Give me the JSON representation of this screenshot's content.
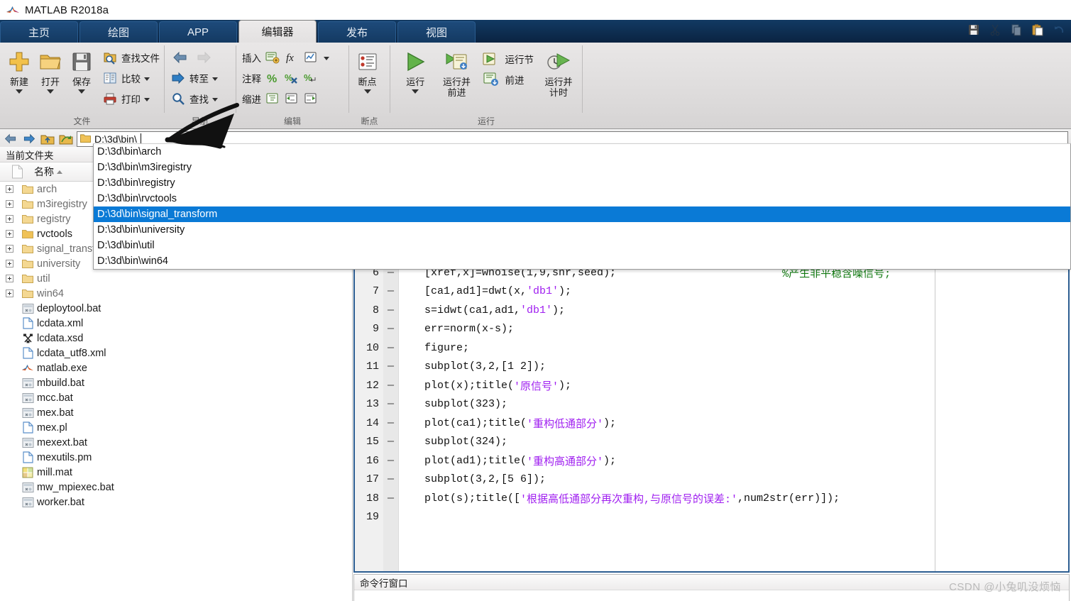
{
  "window": {
    "title": "MATLAB R2018a",
    "logo_icon": "matlab-logo-icon"
  },
  "quick_access": [
    {
      "name": "save-icon",
      "label": "保存",
      "enabled": true
    },
    {
      "name": "cut-icon",
      "label": "剪切",
      "enabled": false
    },
    {
      "name": "copy-icon",
      "label": "复制",
      "enabled": false
    },
    {
      "name": "paste-icon",
      "label": "粘贴",
      "enabled": true
    },
    {
      "name": "undo-icon",
      "label": "撤消",
      "enabled": false
    }
  ],
  "ribbon": {
    "tabs": [
      {
        "label": "主页",
        "active": false
      },
      {
        "label": "绘图",
        "active": false
      },
      {
        "label": "APP",
        "active": false
      },
      {
        "label": "编辑器",
        "active": true
      },
      {
        "label": "发布",
        "active": false
      },
      {
        "label": "视图",
        "active": false
      }
    ],
    "groups": [
      {
        "label": "文件",
        "big_buttons": [
          {
            "label": "新建",
            "icon": "new-file-icon",
            "has_menu": true
          },
          {
            "label": "打开",
            "icon": "open-folder-icon",
            "has_menu": true
          },
          {
            "label": "保存",
            "icon": "save-disk-icon",
            "has_menu": true
          }
        ],
        "small_buttons": [
          {
            "label": "查找文件",
            "icon": "find-files-icon",
            "has_menu": false
          },
          {
            "label": "比较",
            "icon": "compare-icon",
            "has_menu": true
          },
          {
            "label": "打印",
            "icon": "print-icon",
            "has_menu": true
          }
        ]
      },
      {
        "label": "导航",
        "small_buttons": [
          {
            "label": "",
            "icon": "back-arrow-icon",
            "has_menu": false
          },
          {
            "label": "",
            "icon": "forward-arrow-icon",
            "has_menu": false
          },
          {
            "label": "转至",
            "icon": "goto-icon",
            "has_menu": true
          },
          {
            "label": "查找",
            "icon": "search-icon",
            "has_menu": true
          }
        ]
      },
      {
        "label": "编辑",
        "rows": [
          {
            "label": "插入",
            "icons": [
              "insert-block-icon",
              "insert-function-icon",
              "insert-section-icon"
            ],
            "has_menu": true
          },
          {
            "label": "注释",
            "icons": [
              "comment-icon",
              "uncomment-icon",
              "wrap-comment-icon"
            ],
            "has_menu": false
          },
          {
            "label": "缩进",
            "icons": [
              "smart-indent-icon",
              "indent-right-icon",
              "indent-left-icon"
            ],
            "has_menu": false
          }
        ]
      },
      {
        "label": "断点",
        "big_buttons": [
          {
            "label": "断点",
            "icon": "breakpoint-icon",
            "has_menu": true
          }
        ]
      },
      {
        "label": "运行",
        "big_buttons": [
          {
            "label": "运行",
            "icon": "run-icon",
            "has_menu": true
          },
          {
            "label": "运行并\n前进",
            "icon": "run-advance-icon",
            "has_menu": false
          },
          {
            "label": "运行并\n计时",
            "icon": "run-time-icon",
            "has_menu": false
          }
        ],
        "small_buttons": [
          {
            "label": "运行节",
            "icon": "run-section-icon"
          },
          {
            "label": "前进",
            "icon": "advance-icon"
          }
        ]
      }
    ]
  },
  "navbar": {
    "buttons": [
      {
        "name": "back-button",
        "icon": "back-arrow-icon"
      },
      {
        "name": "forward-button",
        "icon": "forward-arrow-icon"
      },
      {
        "name": "up-one-level-button",
        "icon": "up-folder-icon"
      },
      {
        "name": "browse-folder-button",
        "icon": "browse-folder-icon"
      }
    ],
    "address_value": "D:\\3d\\bin\\",
    "folder_icon": "folder-icon"
  },
  "address_dropdown": {
    "selected_index": 4,
    "items": [
      "D:\\3d\\bin\\arch",
      "D:\\3d\\bin\\m3iregistry",
      "D:\\3d\\bin\\registry",
      "D:\\3d\\bin\\rvctools",
      "D:\\3d\\bin\\signal_transform",
      "D:\\3d\\bin\\university",
      "D:\\3d\\bin\\util",
      "D:\\3d\\bin\\win64"
    ]
  },
  "current_folder": {
    "panel_title": "当前文件夹",
    "column_header": "名称",
    "sort": "asc",
    "folders": [
      {
        "name": "arch",
        "expandable": true,
        "emphasis": false
      },
      {
        "name": "m3iregistry",
        "expandable": true,
        "emphasis": false
      },
      {
        "name": "registry",
        "expandable": true,
        "emphasis": false
      },
      {
        "name": "rvctools",
        "expandable": true,
        "emphasis": true
      },
      {
        "name": "signal_transform",
        "expandable": true,
        "emphasis": false
      },
      {
        "name": "university",
        "expandable": true,
        "emphasis": false
      },
      {
        "name": "util",
        "expandable": true,
        "emphasis": false
      },
      {
        "name": "win64",
        "expandable": true,
        "emphasis": false
      }
    ],
    "files": [
      {
        "name": "deploytool.bat",
        "icon": "bat-file-icon"
      },
      {
        "name": "lcdata.xml",
        "icon": "xml-file-icon"
      },
      {
        "name": "lcdata.xsd",
        "icon": "xsd-file-icon"
      },
      {
        "name": "lcdata_utf8.xml",
        "icon": "xml-file-icon"
      },
      {
        "name": "matlab.exe",
        "icon": "matlab-exe-icon"
      },
      {
        "name": "mbuild.bat",
        "icon": "bat-file-icon"
      },
      {
        "name": "mcc.bat",
        "icon": "bat-file-icon"
      },
      {
        "name": "mex.bat",
        "icon": "bat-file-icon"
      },
      {
        "name": "mex.pl",
        "icon": "pl-file-icon"
      },
      {
        "name": "mexext.bat",
        "icon": "bat-file-icon"
      },
      {
        "name": "mexutils.pm",
        "icon": "pm-file-icon"
      },
      {
        "name": "mill.mat",
        "icon": "mat-file-icon"
      },
      {
        "name": "mw_mpiexec.bat",
        "icon": "bat-file-icon"
      },
      {
        "name": "worker.bat",
        "icon": "bat-file-icon"
      }
    ]
  },
  "editor": {
    "first_visible_line": 6,
    "lines": [
      {
        "no": 6,
        "mark": "—",
        "segments": [
          {
            "t": "[xref,x]=wnoise(1,9,snr,seed);",
            "c": "plain"
          },
          {
            "t": "                          ",
            "c": "plain"
          },
          {
            "t": "%产生非平稳含噪信号;",
            "c": "cmt"
          }
        ]
      },
      {
        "no": 7,
        "mark": "—",
        "segments": [
          {
            "t": "[ca1,ad1]=dwt(x,",
            "c": "plain"
          },
          {
            "t": "'db1'",
            "c": "str"
          },
          {
            "t": ");",
            "c": "plain"
          }
        ]
      },
      {
        "no": 8,
        "mark": "—",
        "segments": [
          {
            "t": "s=idwt(ca1,ad1,",
            "c": "plain"
          },
          {
            "t": "'db1'",
            "c": "str"
          },
          {
            "t": ");",
            "c": "plain"
          }
        ]
      },
      {
        "no": 9,
        "mark": "—",
        "segments": [
          {
            "t": "err=norm(x-s);",
            "c": "plain"
          }
        ]
      },
      {
        "no": 10,
        "mark": "—",
        "segments": [
          {
            "t": "figure;",
            "c": "plain"
          }
        ]
      },
      {
        "no": 11,
        "mark": "—",
        "segments": [
          {
            "t": "subplot(3,2,[1 2]);",
            "c": "plain"
          }
        ]
      },
      {
        "no": 12,
        "mark": "—",
        "segments": [
          {
            "t": "plot(x);title(",
            "c": "plain"
          },
          {
            "t": "'原信号'",
            "c": "str"
          },
          {
            "t": ");",
            "c": "plain"
          }
        ]
      },
      {
        "no": 13,
        "mark": "—",
        "segments": [
          {
            "t": "subplot(323);",
            "c": "plain"
          }
        ]
      },
      {
        "no": 14,
        "mark": "—",
        "segments": [
          {
            "t": "plot(ca1);title(",
            "c": "plain"
          },
          {
            "t": "'重构低通部分'",
            "c": "str"
          },
          {
            "t": ");",
            "c": "plain"
          }
        ]
      },
      {
        "no": 15,
        "mark": "—",
        "segments": [
          {
            "t": "subplot(324);",
            "c": "plain"
          }
        ]
      },
      {
        "no": 16,
        "mark": "—",
        "segments": [
          {
            "t": "plot(ad1);title(",
            "c": "plain"
          },
          {
            "t": "'重构高通部分'",
            "c": "str"
          },
          {
            "t": ");",
            "c": "plain"
          }
        ]
      },
      {
        "no": 17,
        "mark": "—",
        "segments": [
          {
            "t": "subplot(3,2,[5 6]);",
            "c": "plain"
          }
        ]
      },
      {
        "no": 18,
        "mark": "—",
        "segments": [
          {
            "t": "plot(s);title([",
            "c": "plain"
          },
          {
            "t": "'根据高低通部分再次重构,与原信号的误差:'",
            "c": "str"
          },
          {
            "t": ",num2str(err)]);",
            "c": "plain"
          }
        ]
      },
      {
        "no": 19,
        "mark": "",
        "segments": []
      }
    ]
  },
  "command_window": {
    "title": "命令行窗口"
  },
  "watermark": {
    "text": "CSDN @小兔叽没烦恼"
  },
  "colors": {
    "tab_active_bg": "#eceaea",
    "ribbon_bg": "#e0dede",
    "selection_blue": "#0a7ad6",
    "editor_border": "#2c5d91",
    "string_purple": "#a020f0",
    "comment_green": "#117a11",
    "folder_yellow": "#f5c96a"
  }
}
